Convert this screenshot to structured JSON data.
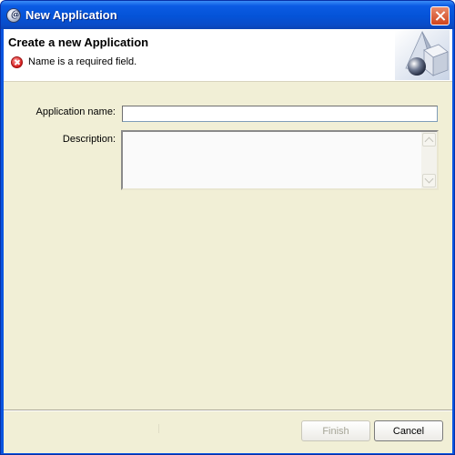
{
  "window": {
    "title": "New Application",
    "app_icon": "eclipse-app-icon",
    "close_icon": "close-icon"
  },
  "banner": {
    "title": "Create a new Application",
    "error_icon": "error-icon",
    "message": "Name is a required field.",
    "graphic": "wizard-shapes-graphic"
  },
  "form": {
    "name_label": "Application name:",
    "name_value": "",
    "description_label": "Description:",
    "description_value": ""
  },
  "buttons": {
    "finish_label": "Finish",
    "finish_enabled": false,
    "cancel_label": "Cancel"
  },
  "colors": {
    "titlebar": "#0a55e0",
    "dialog_background": "#f1efd6",
    "error_red": "#d41c1c"
  }
}
